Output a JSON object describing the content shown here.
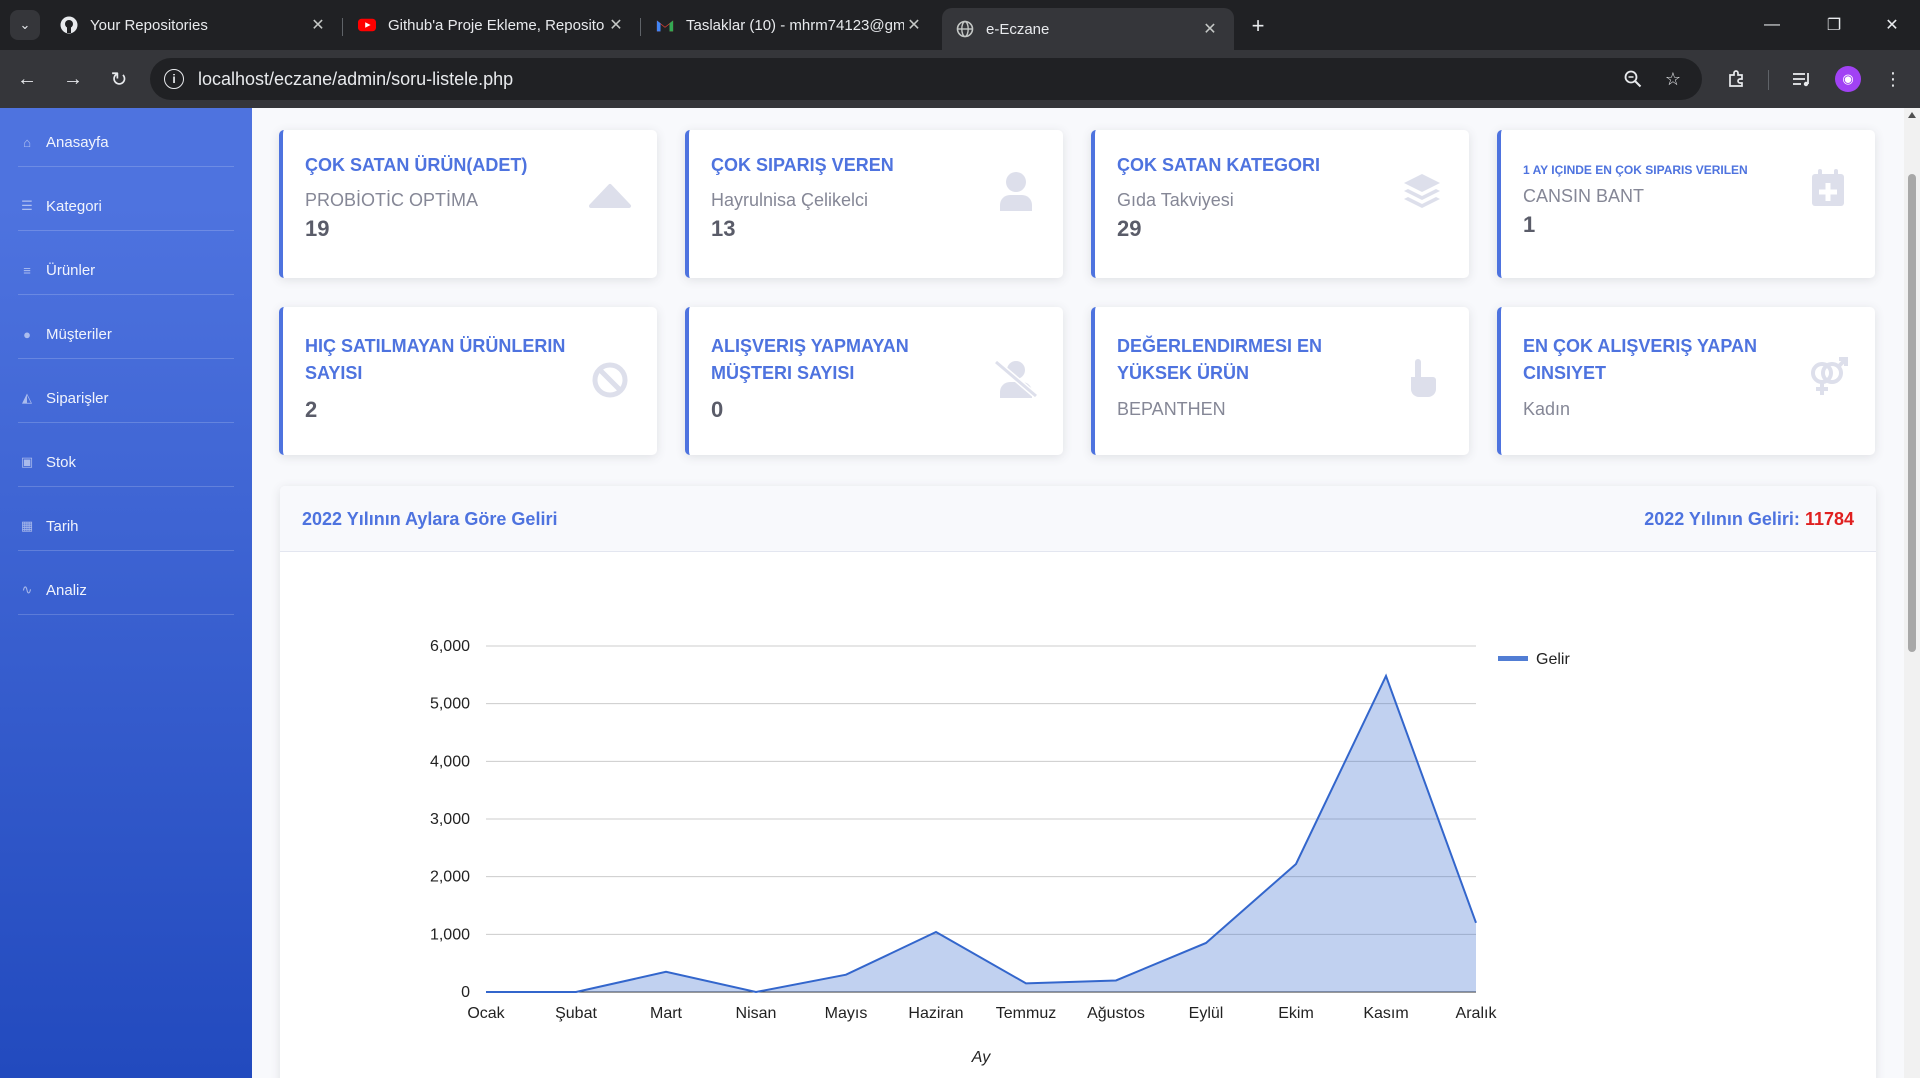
{
  "browser": {
    "tabs": [
      {
        "title": "Your Repositories",
        "icon": "github-icon"
      },
      {
        "title": "Github'a Proje Ekleme, Reposito",
        "icon": "youtube-icon"
      },
      {
        "title": "Taslaklar (10) - mhrm74123@gm",
        "icon": "gmail-icon"
      },
      {
        "title": "e-Eczane",
        "icon": "globe-icon",
        "active": true
      }
    ],
    "url": "localhost/eczane/admin/soru-listele.php"
  },
  "sidebar": {
    "items": [
      {
        "label": "Anasayfa",
        "icon": "home-icon"
      },
      {
        "label": "Kategori",
        "icon": "layers-icon"
      },
      {
        "label": "Ürünler",
        "icon": "list-icon"
      },
      {
        "label": "Müşteriler",
        "icon": "user-icon"
      },
      {
        "label": "Siparişler",
        "icon": "cart-icon"
      },
      {
        "label": "Stok",
        "icon": "dolly-icon"
      },
      {
        "label": "Tarih",
        "icon": "calendar-icon"
      },
      {
        "label": "Analiz",
        "icon": "chart-line-icon"
      }
    ]
  },
  "cards": [
    {
      "title": "ÇOK SATAN ÜRÜN(ADET)",
      "subtitle": "PROBİOTİC OPTİMA",
      "value": "19",
      "icon": "caret-up-icon"
    },
    {
      "title": "ÇOK SIPARIŞ VEREN",
      "subtitle": "Hayrulnisa Çelikelci",
      "value": "13",
      "icon": "user-icon"
    },
    {
      "title": "ÇOK SATAN KATEGORI",
      "subtitle": "Gıda Takviyesi",
      "value": "29",
      "icon": "layers-icon"
    },
    {
      "title": "1 AY IÇINDE EN ÇOK SIPARIS VERILEN",
      "subtitle": "CANSIN BANT",
      "value": "1",
      "icon": "calendar-plus-icon"
    },
    {
      "title": "HIÇ SATILMAYAN ÜRÜNLERIN SAYISI",
      "subtitle": "",
      "value": "2",
      "icon": "ban-icon"
    },
    {
      "title": "ALIŞVERIŞ YAPMAYAN MÜŞTERI SAYISI",
      "subtitle": "",
      "value": "0",
      "icon": "user-slash-icon"
    },
    {
      "title": "DEĞERLENDIRMESI EN YÜKSEK ÜRÜN",
      "subtitle": "BEPANTHEN",
      "value": "",
      "icon": "hand-pointer-icon"
    },
    {
      "title": "EN ÇOK ALIŞVERIŞ YAPAN CINSIYET",
      "subtitle": "Kadın",
      "value": "",
      "icon": "venus-mars-icon"
    }
  ],
  "chart_panel": {
    "title": "2022 Yılının Aylara Göre Geliri",
    "total_label": "2022 Yılının Geliri:",
    "total_value": "11784"
  },
  "chart_data": {
    "type": "area",
    "categories": [
      "Ocak",
      "Şubat",
      "Mart",
      "Nisan",
      "Mayıs",
      "Haziran",
      "Temmuz",
      "Ağustos",
      "Eylül",
      "Ekim",
      "Kasım",
      "Aralık"
    ],
    "series": [
      {
        "name": "Gelir",
        "values": [
          0,
          0,
          350,
          0,
          300,
          1040,
          150,
          200,
          850,
          2220,
          5480,
          1200
        ],
        "color": "#3366cc"
      }
    ],
    "xlabel": "Ay",
    "ylabel": "",
    "ylim": [
      0,
      6000
    ],
    "yticks": [
      "0",
      "1,000",
      "2,000",
      "3,000",
      "4,000",
      "5,000",
      "6,000"
    ],
    "grid": true,
    "legend": "top-right"
  }
}
